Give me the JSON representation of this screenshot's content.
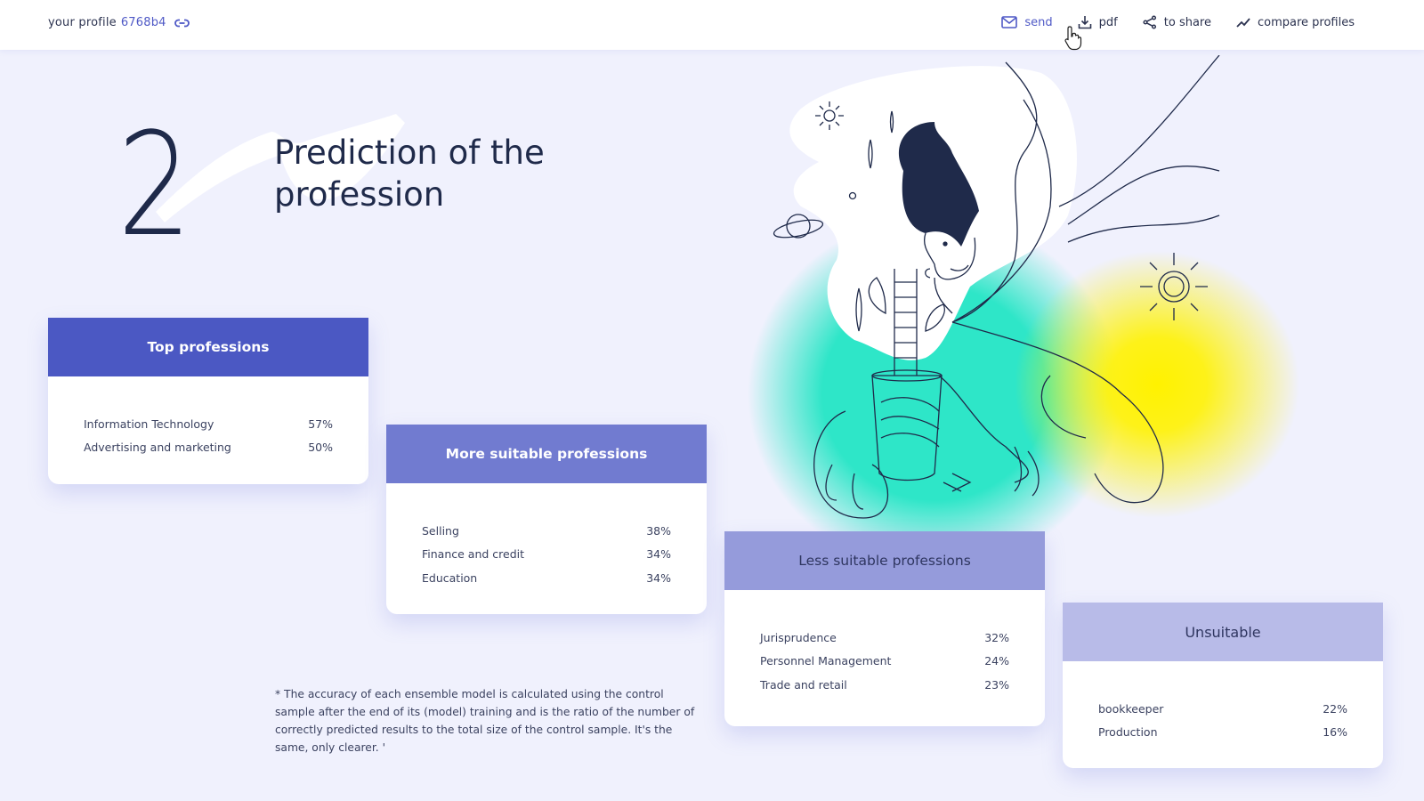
{
  "header": {
    "profile_label": "your profile",
    "profile_id": "6768b4",
    "link_icon": "link-icon",
    "actions": [
      {
        "label": "send",
        "icon": "mail-icon",
        "active": true
      },
      {
        "label": "pdf",
        "icon": "download-icon",
        "active": false
      },
      {
        "label": "to share",
        "icon": "share-icon",
        "active": false
      },
      {
        "label": "compare profiles",
        "icon": "trend-line-icon",
        "active": false
      }
    ]
  },
  "section": {
    "number": "2",
    "title": "Prediction of the profession"
  },
  "cards": [
    {
      "title": "Top professions",
      "header_color": "#4b58c3",
      "items": [
        {
          "name": "Information Technology",
          "value": "57%"
        },
        {
          "name": "Advertising and marketing",
          "value": "50%"
        }
      ]
    },
    {
      "title": "More suitable professions",
      "header_color": "#717bd0",
      "items": [
        {
          "name": "Selling",
          "value": "38%"
        },
        {
          "name": "Finance and credit",
          "value": "34%"
        },
        {
          "name": "Education",
          "value": "34%"
        }
      ]
    },
    {
      "title": "Less suitable professions",
      "header_color": "#959bdb",
      "items": [
        {
          "name": "Jurisprudence",
          "value": "32%"
        },
        {
          "name": "Personnel Management",
          "value": "24%"
        },
        {
          "name": "Trade and retail",
          "value": "23%"
        }
      ]
    },
    {
      "title": "Unsuitable",
      "header_color": "#b8bbe8",
      "items": [
        {
          "name": "bookkeeper",
          "value": "22%"
        },
        {
          "name": "Production",
          "value": "16%"
        }
      ]
    }
  ],
  "footnote": "* The accuracy of each ensemble model is calculated using the control sample after the end of its (model) training and is the ratio of the number of correctly predicted results to the total size of the control sample. It's the same, only clearer. '",
  "colors": {
    "background": "#f0f1fd",
    "accent": "#4f59c6",
    "illustration_teal": "#2ee6c8",
    "illustration_yellow": "#fff200",
    "ink": "#1f2a4a"
  }
}
